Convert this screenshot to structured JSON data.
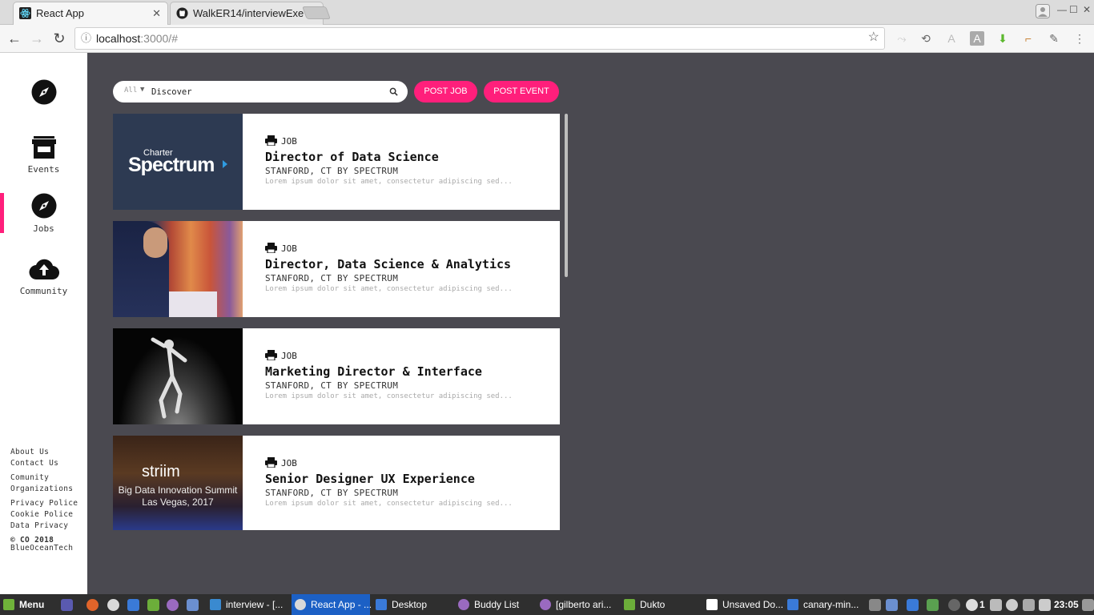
{
  "browser": {
    "tabs": [
      {
        "title": "React App",
        "active": true
      },
      {
        "title": "WalkER14/interviewExe",
        "active": false
      }
    ],
    "url_host": "localhost",
    "url_path": ":3000/#"
  },
  "sidebar": {
    "items": [
      {
        "label": "",
        "icon": "compass-icon",
        "active": false
      },
      {
        "label": "Events",
        "icon": "store-icon",
        "active": false
      },
      {
        "label": "Jobs",
        "icon": "compass-icon",
        "active": true
      },
      {
        "label": "Community",
        "icon": "cloud-upload-icon",
        "active": false
      }
    ],
    "footer": {
      "about": "About Us",
      "contact": "Contact Us",
      "community_1": "Comunity",
      "community_2": "Organizations",
      "privacy": "Privacy Police",
      "cookie": "Cookie Police",
      "data": "Data Privacy",
      "copyright": "© CO 2018",
      "company": "BlueOceanTech"
    }
  },
  "search": {
    "category": "All",
    "value": "Discover"
  },
  "actions": {
    "post_job": "POST JOB",
    "post_event": "POST EVENT"
  },
  "listings": [
    {
      "type": "JOB",
      "title": "Director of Data Science",
      "location": "STANFORD, CT BY SPECTRUM",
      "description": "Lorem ipsum dolor sit amet, consectetur adipiscing sed..."
    },
    {
      "type": "JOB",
      "title": "Director, Data Science & Analytics",
      "location": "STANFORD, CT BY SPECTRUM",
      "description": "Lorem ipsum dolor sit amet, consectetur adipiscing sed..."
    },
    {
      "type": "JOB",
      "title": "Marketing Director & Interface",
      "location": "STANFORD, CT BY SPECTRUM",
      "description": "Lorem ipsum dolor sit amet, consectetur adipiscing sed..."
    },
    {
      "type": "JOB",
      "title": "Senior Designer UX Experience",
      "location": "STANFORD, CT BY SPECTRUM",
      "description": "Lorem ipsum dolor sit amet, consectetur adipiscing sed..."
    }
  ],
  "thumbs": {
    "spectrum_small": "Charter",
    "spectrum_big": "Spectrum",
    "striim_logo": "striim",
    "striim_line1": "Big Data Innovation Summit",
    "striim_line2": "Las Vegas, 2017"
  },
  "taskbar": {
    "menu": "Menu",
    "windows": [
      "interview - [...",
      "React App - ...",
      "Desktop",
      "Buddy List",
      "[gilberto ari...",
      "Dukto",
      "Unsaved Do...",
      "canary-min..."
    ],
    "tray_count": "1",
    "clock": "23:05"
  },
  "colors": {
    "accent": "#ff1f7b",
    "background": "#4a4950",
    "taskbar_active": "#1c60c5"
  }
}
